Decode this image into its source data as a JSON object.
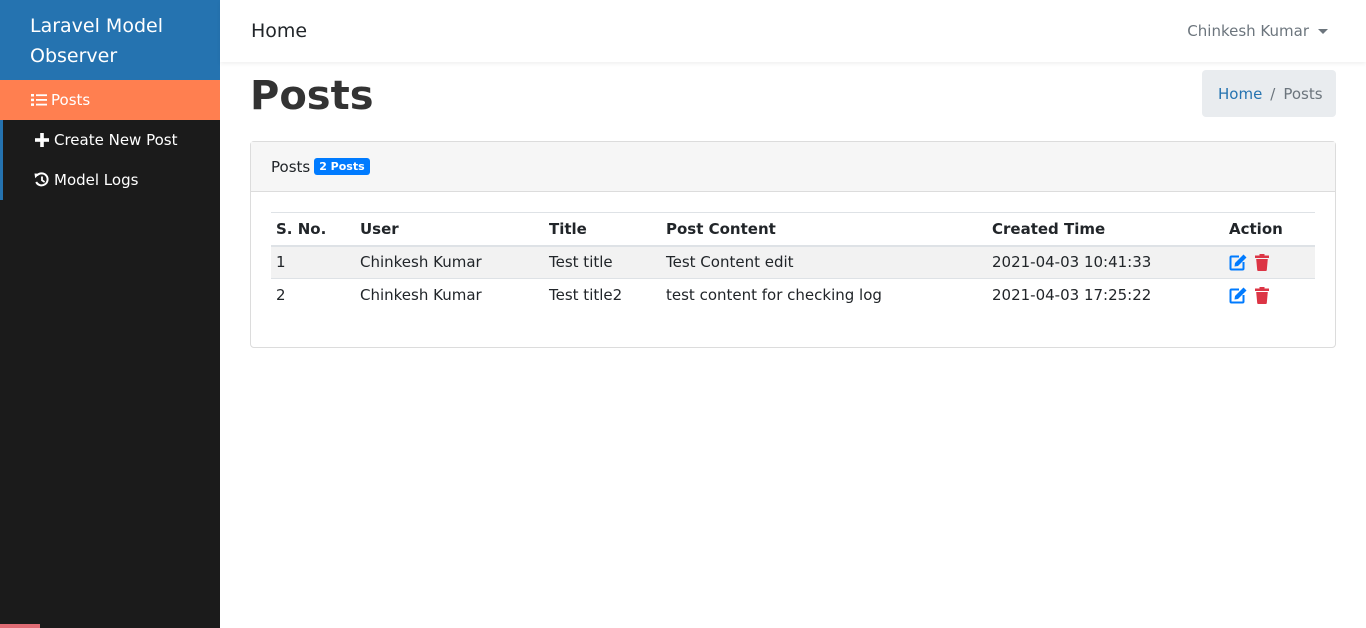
{
  "sidebar": {
    "brand": "Laravel Model Observer",
    "items": [
      {
        "label": "Posts",
        "icon": "list-icon",
        "active": true
      },
      {
        "label": "Create New Post",
        "icon": "plus-icon",
        "active": false
      },
      {
        "label": "Model Logs",
        "icon": "history-icon",
        "active": false
      }
    ]
  },
  "topbar": {
    "home": "Home",
    "user": "Chinkesh Kumar"
  },
  "page": {
    "title": "Posts"
  },
  "breadcrumb": {
    "home": "Home",
    "separator": "/",
    "current": "Posts"
  },
  "card": {
    "header": "Posts",
    "badge": "2 Posts"
  },
  "table": {
    "columns": [
      "S. No.",
      "User",
      "Title",
      "Post Content",
      "Created Time",
      "Action"
    ],
    "rows": [
      {
        "sno": "1",
        "user": "Chinkesh Kumar",
        "title": "Test title",
        "content": "Test Content edit",
        "created": "2021-04-03 10:41:33"
      },
      {
        "sno": "2",
        "user": "Chinkesh Kumar",
        "title": "Test title2",
        "content": "test content for checking log",
        "created": "2021-04-03 17:25:22"
      }
    ]
  },
  "colors": {
    "brand": "#2573b0",
    "sidebar": "#1b1b1b",
    "active": "#ff7f50",
    "badge": "#007bff",
    "edit": "#007bff",
    "delete": "#dc3545"
  }
}
